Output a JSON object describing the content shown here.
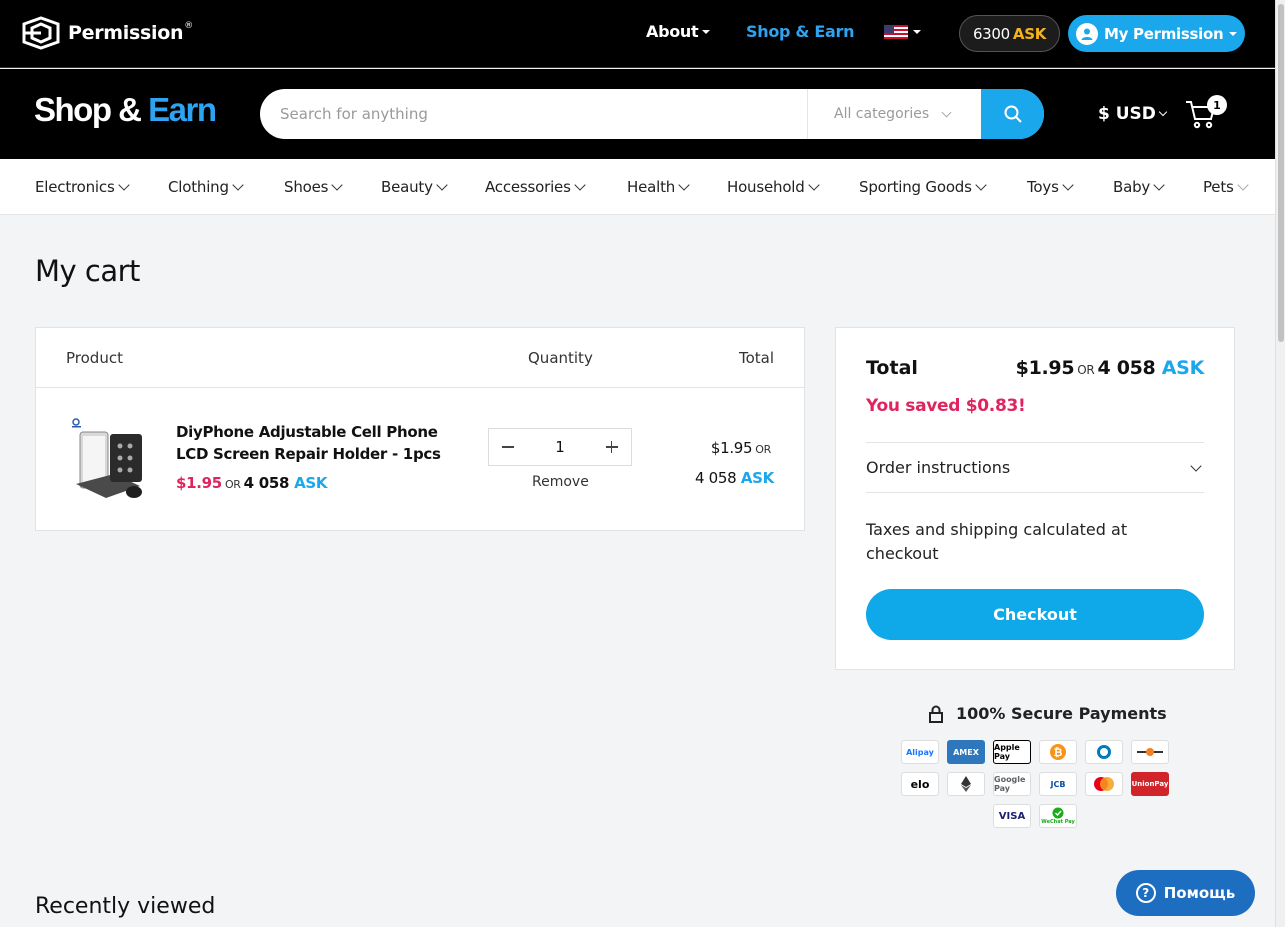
{
  "topbar": {
    "brand": "Permission",
    "brand_mark": "®",
    "about": "About",
    "shop_earn": "Shop & Earn",
    "balance_value": "6300",
    "balance_unit": "ASK",
    "my_permission": "My Permission",
    "flag_icon": "us-flag-icon"
  },
  "header": {
    "logo_shop": "Shop",
    "logo_amp": " & ",
    "logo_earn": "Earn",
    "search_placeholder": "Search for anything",
    "category_select": "All categories",
    "currency": "$ USD",
    "cart_count": "1"
  },
  "categories": [
    "Electronics",
    "Clothing",
    "Shoes",
    "Beauty",
    "Accessories",
    "Health",
    "Household",
    "Sporting Goods",
    "Toys",
    "Baby",
    "Pets"
  ],
  "page": {
    "title": "My cart"
  },
  "cart": {
    "col_product": "Product",
    "col_quantity": "Quantity",
    "col_total": "Total",
    "items": [
      {
        "name": "DiyPhone Adjustable Cell Phone LCD Screen Repair Holder - 1pcs",
        "price_usd": "$1.95",
        "or": "OR",
        "price_ask_value": "4 058",
        "price_ask_unit": "ASK",
        "quantity": "1",
        "remove_label": "Remove",
        "total_usd": "$1.95",
        "total_ask_value": "4 058",
        "total_ask_unit": "ASK"
      }
    ]
  },
  "summary": {
    "total_label": "Total",
    "total_usd": "$1.95",
    "or": "OR",
    "total_ask_value": "4 058",
    "total_ask_unit": "ASK",
    "saved": "You saved $0.83!",
    "order_instructions": "Order instructions",
    "taxes_note": "Taxes and shipping calculated at checkout",
    "checkout": "Checkout"
  },
  "payments": {
    "title": "100% Secure Payments",
    "methods": [
      "Alipay",
      "AMEX",
      "Apple Pay",
      "Bitcoin",
      "Diners Club",
      "Discover",
      "elo",
      "Ethereum",
      "Google Pay",
      "JCB",
      "Mastercard",
      "UnionPay",
      "VISA",
      "WeChat Pay"
    ]
  },
  "recent": {
    "title": "Recently viewed"
  },
  "help": {
    "label": "Помощь"
  },
  "colors": {
    "accent": "#1aa7ec",
    "sale_red": "#e0245e",
    "ask_gold": "#f6b21b"
  }
}
